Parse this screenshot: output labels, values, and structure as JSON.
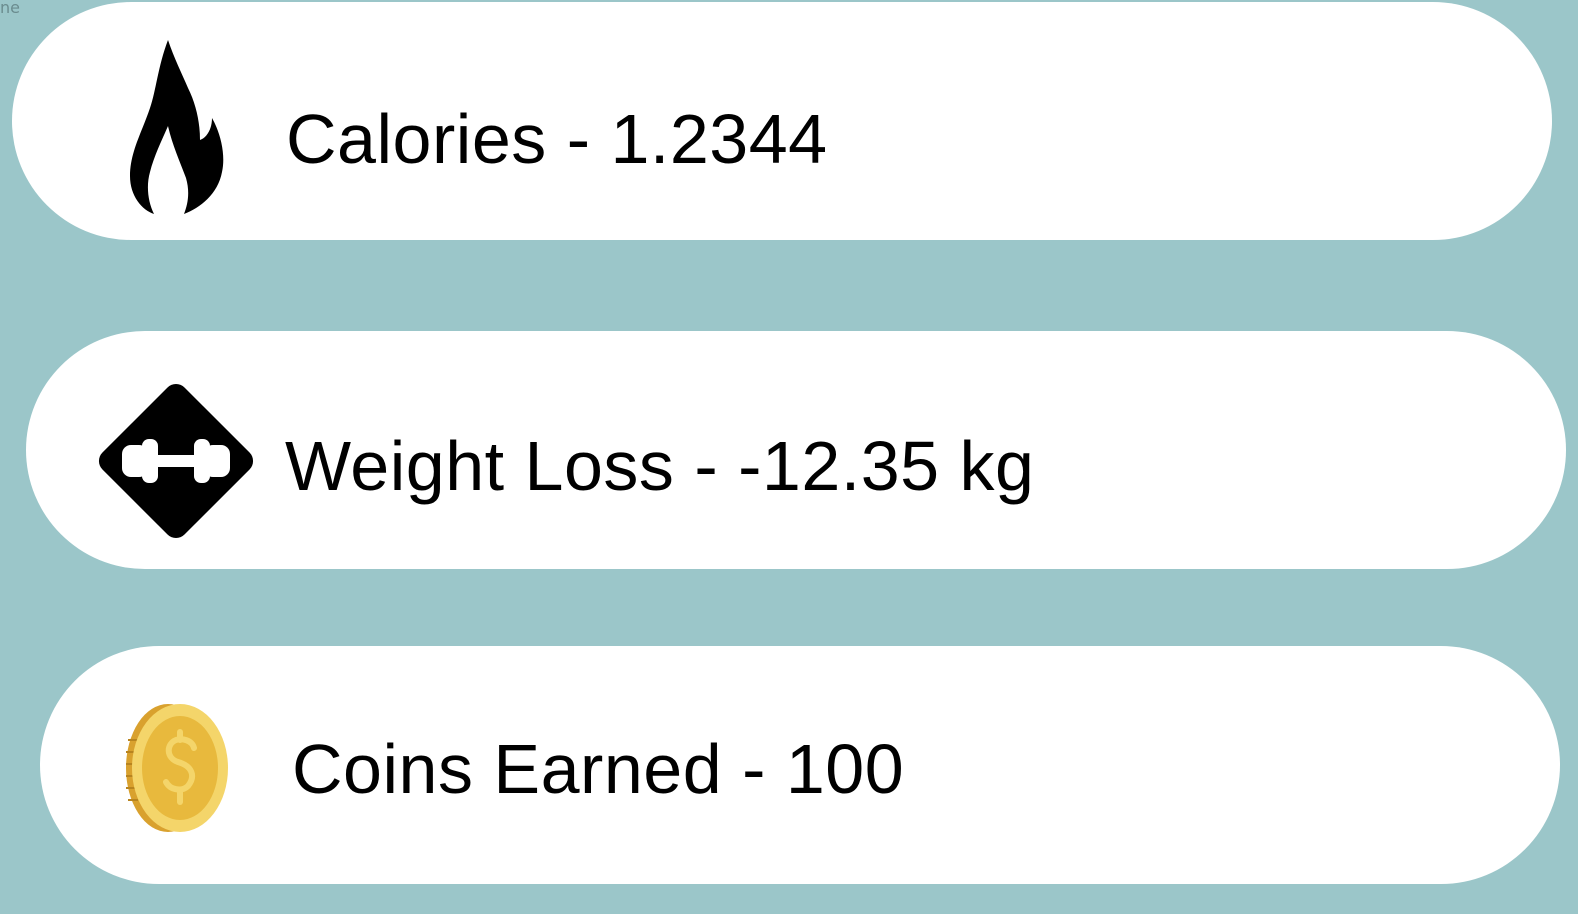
{
  "corner_label": "ne",
  "stats": {
    "calories": {
      "label": "Calories - 1.2344",
      "icon": "flame-icon"
    },
    "weight_loss": {
      "label": "Weight Loss - -12.35 kg",
      "icon": "dumbbell-icon"
    },
    "coins": {
      "label": "Coins Earned - 100",
      "icon": "coin-icon"
    }
  },
  "colors": {
    "background": "#9bc6c9",
    "card": "#ffffff",
    "text": "#000000",
    "coin_gold": "#e8b93d",
    "coin_light": "#f4d56a"
  }
}
